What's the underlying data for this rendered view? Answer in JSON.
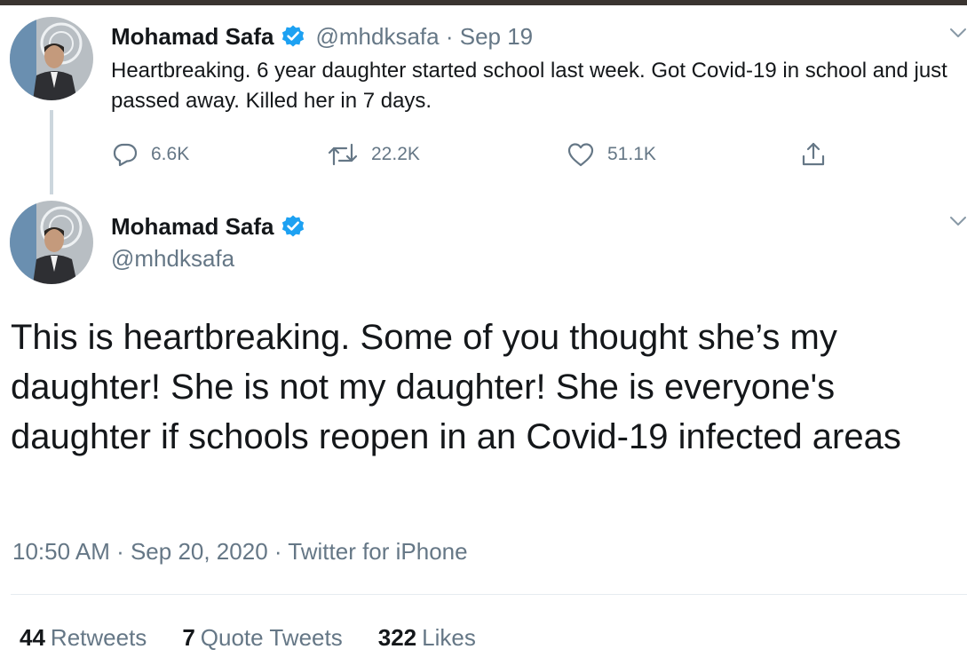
{
  "icons": {
    "verified": "verified-badge-icon",
    "caret": "chevron-down-icon",
    "reply": "reply-bubble-icon",
    "retweet": "retweet-icon",
    "like": "heart-icon",
    "share": "share-upload-icon"
  },
  "colors": {
    "verified_blue": "#1da1f2",
    "secondary_text": "#657786",
    "primary_text": "#14171a",
    "thread_line": "#ccd6dd",
    "divider": "#e6ecf0"
  },
  "parent_tweet": {
    "author_name": "Mohamad Safa",
    "meta": "@mhdksafa · Sep 19",
    "text": "Heartbreaking. 6 year daughter started school last week. Got Covid-19 in school and just passed away. Killed her in 7 days.",
    "reply_count": "6.6K",
    "retweet_count": "22.2K",
    "like_count": "51.1K"
  },
  "main_tweet": {
    "author_name": "Mohamad Safa",
    "handle": "@mhdksafa",
    "text": "This is heartbreaking. Some of you thought she’s my daughter! She is not my daughter! She is everyone's daughter if schools reopen in an Covid-19 infected areas",
    "timestamp": "10:50 AM · Sep 20, 2020 · Twitter for iPhone",
    "stats": {
      "retweets_count": "44",
      "retweets_label": "Retweets",
      "quote_tweets_count": "7",
      "quote_tweets_label": "Quote Tweets",
      "likes_count": "322",
      "likes_label": "Likes"
    }
  }
}
